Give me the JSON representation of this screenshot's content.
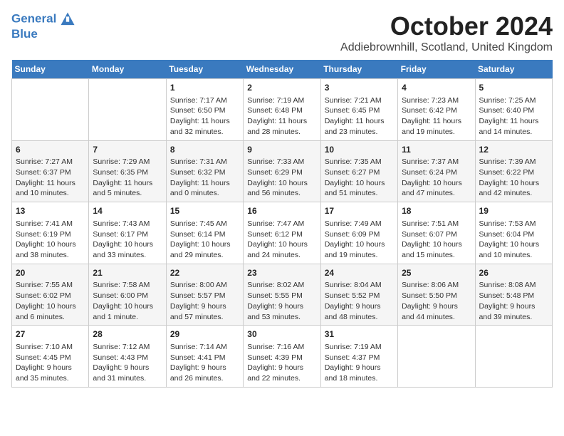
{
  "header": {
    "logo_line1": "General",
    "logo_line2": "Blue",
    "month_title": "October 2024",
    "location": "Addiebrownhill, Scotland, United Kingdom"
  },
  "days_of_week": [
    "Sunday",
    "Monday",
    "Tuesday",
    "Wednesday",
    "Thursday",
    "Friday",
    "Saturday"
  ],
  "weeks": [
    [
      {
        "day": "",
        "content": ""
      },
      {
        "day": "",
        "content": ""
      },
      {
        "day": "1",
        "content": "Sunrise: 7:17 AM\nSunset: 6:50 PM\nDaylight: 11 hours\nand 32 minutes."
      },
      {
        "day": "2",
        "content": "Sunrise: 7:19 AM\nSunset: 6:48 PM\nDaylight: 11 hours\nand 28 minutes."
      },
      {
        "day": "3",
        "content": "Sunrise: 7:21 AM\nSunset: 6:45 PM\nDaylight: 11 hours\nand 23 minutes."
      },
      {
        "day": "4",
        "content": "Sunrise: 7:23 AM\nSunset: 6:42 PM\nDaylight: 11 hours\nand 19 minutes."
      },
      {
        "day": "5",
        "content": "Sunrise: 7:25 AM\nSunset: 6:40 PM\nDaylight: 11 hours\nand 14 minutes."
      }
    ],
    [
      {
        "day": "6",
        "content": "Sunrise: 7:27 AM\nSunset: 6:37 PM\nDaylight: 11 hours\nand 10 minutes."
      },
      {
        "day": "7",
        "content": "Sunrise: 7:29 AM\nSunset: 6:35 PM\nDaylight: 11 hours\nand 5 minutes."
      },
      {
        "day": "8",
        "content": "Sunrise: 7:31 AM\nSunset: 6:32 PM\nDaylight: 11 hours\nand 0 minutes."
      },
      {
        "day": "9",
        "content": "Sunrise: 7:33 AM\nSunset: 6:29 PM\nDaylight: 10 hours\nand 56 minutes."
      },
      {
        "day": "10",
        "content": "Sunrise: 7:35 AM\nSunset: 6:27 PM\nDaylight: 10 hours\nand 51 minutes."
      },
      {
        "day": "11",
        "content": "Sunrise: 7:37 AM\nSunset: 6:24 PM\nDaylight: 10 hours\nand 47 minutes."
      },
      {
        "day": "12",
        "content": "Sunrise: 7:39 AM\nSunset: 6:22 PM\nDaylight: 10 hours\nand 42 minutes."
      }
    ],
    [
      {
        "day": "13",
        "content": "Sunrise: 7:41 AM\nSunset: 6:19 PM\nDaylight: 10 hours\nand 38 minutes."
      },
      {
        "day": "14",
        "content": "Sunrise: 7:43 AM\nSunset: 6:17 PM\nDaylight: 10 hours\nand 33 minutes."
      },
      {
        "day": "15",
        "content": "Sunrise: 7:45 AM\nSunset: 6:14 PM\nDaylight: 10 hours\nand 29 minutes."
      },
      {
        "day": "16",
        "content": "Sunrise: 7:47 AM\nSunset: 6:12 PM\nDaylight: 10 hours\nand 24 minutes."
      },
      {
        "day": "17",
        "content": "Sunrise: 7:49 AM\nSunset: 6:09 PM\nDaylight: 10 hours\nand 19 minutes."
      },
      {
        "day": "18",
        "content": "Sunrise: 7:51 AM\nSunset: 6:07 PM\nDaylight: 10 hours\nand 15 minutes."
      },
      {
        "day": "19",
        "content": "Sunrise: 7:53 AM\nSunset: 6:04 PM\nDaylight: 10 hours\nand 10 minutes."
      }
    ],
    [
      {
        "day": "20",
        "content": "Sunrise: 7:55 AM\nSunset: 6:02 PM\nDaylight: 10 hours\nand 6 minutes."
      },
      {
        "day": "21",
        "content": "Sunrise: 7:58 AM\nSunset: 6:00 PM\nDaylight: 10 hours\nand 1 minute."
      },
      {
        "day": "22",
        "content": "Sunrise: 8:00 AM\nSunset: 5:57 PM\nDaylight: 9 hours\nand 57 minutes."
      },
      {
        "day": "23",
        "content": "Sunrise: 8:02 AM\nSunset: 5:55 PM\nDaylight: 9 hours\nand 53 minutes."
      },
      {
        "day": "24",
        "content": "Sunrise: 8:04 AM\nSunset: 5:52 PM\nDaylight: 9 hours\nand 48 minutes."
      },
      {
        "day": "25",
        "content": "Sunrise: 8:06 AM\nSunset: 5:50 PM\nDaylight: 9 hours\nand 44 minutes."
      },
      {
        "day": "26",
        "content": "Sunrise: 8:08 AM\nSunset: 5:48 PM\nDaylight: 9 hours\nand 39 minutes."
      }
    ],
    [
      {
        "day": "27",
        "content": "Sunrise: 7:10 AM\nSunset: 4:45 PM\nDaylight: 9 hours\nand 35 minutes."
      },
      {
        "day": "28",
        "content": "Sunrise: 7:12 AM\nSunset: 4:43 PM\nDaylight: 9 hours\nand 31 minutes."
      },
      {
        "day": "29",
        "content": "Sunrise: 7:14 AM\nSunset: 4:41 PM\nDaylight: 9 hours\nand 26 minutes."
      },
      {
        "day": "30",
        "content": "Sunrise: 7:16 AM\nSunset: 4:39 PM\nDaylight: 9 hours\nand 22 minutes."
      },
      {
        "day": "31",
        "content": "Sunrise: 7:19 AM\nSunset: 4:37 PM\nDaylight: 9 hours\nand 18 minutes."
      },
      {
        "day": "",
        "content": ""
      },
      {
        "day": "",
        "content": ""
      }
    ]
  ]
}
